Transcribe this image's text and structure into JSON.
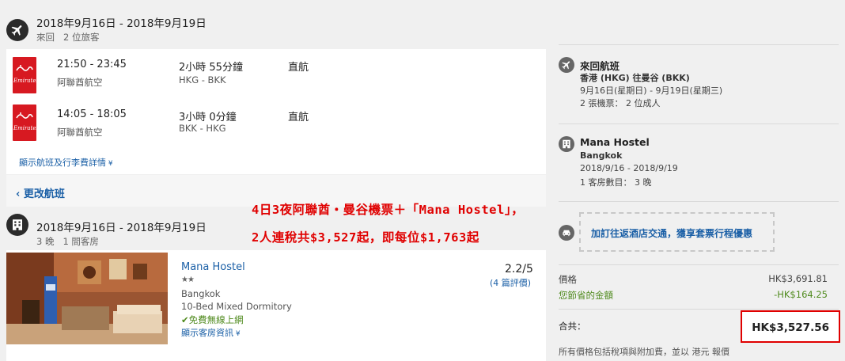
{
  "flight": {
    "dates": "2018年9月16日 - 2018年9月19日",
    "trip_info": "來回   2 位旅客",
    "segments": [
      {
        "airline_logo": "Emirates",
        "time": "21:50 - 23:45",
        "airline": "阿聯酋航空",
        "duration": "2小時 55分鐘",
        "route": "HKG - BKK",
        "stops": "直航"
      },
      {
        "airline_logo": "Emirates",
        "time": "14:05 - 18:05",
        "airline": "阿聯酋航空",
        "duration": "3小時 0分鐘",
        "route": "BKK - HKG",
        "stops": "直航"
      }
    ],
    "details_link": "顯示航班及行李費詳情",
    "change_link": "更改航班"
  },
  "hotel": {
    "dates": "2018年9月16日 - 2018年9月19日",
    "stay_info": "3 晚   1 間客房",
    "name": "Mana Hostel",
    "stars": 2,
    "city": "Bangkok",
    "room": "10-Bed Mixed Dormitory",
    "wifi": "免費無線上網",
    "room_info_link": "顯示客房資訊",
    "rating": "2.2/5",
    "reviews": "(4 篇評價)"
  },
  "promo": {
    "line1": "4日3夜阿聯酋・曼谷機票＋「Mana Hostel」，",
    "line2": "2人連稅共$3,527起，即每位$1,763起"
  },
  "summary": {
    "flight_title": "來回航班",
    "flight_route": "香港 (HKG) 往曼谷 (BKK)",
    "flight_dates": "9月16日(星期日) - 9月19日(星期三)",
    "flight_tickets": "2 張機票： 2 位成人",
    "hotel_title": "Mana Hostel",
    "hotel_city": "Bangkok",
    "hotel_dates": "2018/9/16 - 2018/9/19",
    "hotel_rooms": "1 客房數目： 3 晚",
    "transfer_link": "加訂往返酒店交通，獲享套票行程優惠",
    "price_label": "價格",
    "price_value": "HK$3,691.81",
    "saved_label": "您節省的金額",
    "saved_value": "-HK$164.25",
    "total_label": "合共：",
    "total_value": "HK$3,527.56",
    "footnote": "所有價格包括稅項與附加費，並以 港元 報價"
  },
  "colors": {
    "link": "#1a5fa6",
    "promo": "#e00000",
    "saved": "#4f8a1d",
    "emirates": "#d71921"
  }
}
